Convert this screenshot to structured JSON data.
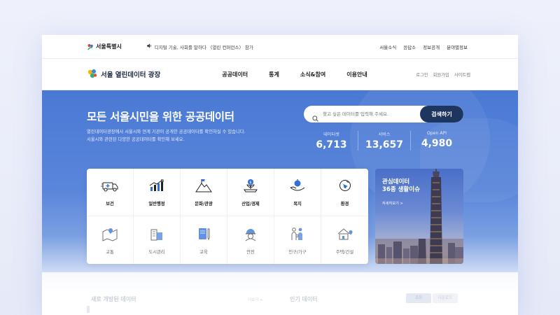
{
  "topbar": {
    "city_name": "서울특별시",
    "notice": "디지털 기술, 사회를 말하다 〈열린 컨퍼런스〉 참가",
    "links": [
      "서울소식",
      "응답소",
      "정보공개",
      "분야별정보"
    ]
  },
  "nav": {
    "site_name": "서울 열린데이터 광장",
    "menu": [
      "공공데이터",
      "통계",
      "소식&참여",
      "이용안내"
    ],
    "member_links": [
      "로그인",
      "회원가입",
      "사이트맵"
    ]
  },
  "hero": {
    "title": "모든 서울시민을 위한 공공데이터",
    "desc_line1": "열린데이터광장에서 서울시와 연계 기관이 공개한 공공데이터를 확인하실 수 있습니다.",
    "desc_line2": "서울시와 관련된 다양한 공공데이터를 확인해 보세요.",
    "search_placeholder": "찾고 싶은 데이터를 입력해 주세요.",
    "search_button": "검색하기",
    "stats": [
      {
        "label": "데이터셋",
        "value": "6,713"
      },
      {
        "label": "서비스",
        "value": "13,657"
      },
      {
        "label": "Open API",
        "value": "4,980"
      }
    ]
  },
  "categories": [
    {
      "label": "보건",
      "icon": "ambulance-icon"
    },
    {
      "label": "일반행정",
      "icon": "chart-growth-icon"
    },
    {
      "label": "문화/관광",
      "icon": "mountain-flag-icon"
    },
    {
      "label": "산업/경제",
      "icon": "money-plant-icon"
    },
    {
      "label": "복지",
      "icon": "hand-heart-icon"
    },
    {
      "label": "환경",
      "icon": "globe-leaf-icon"
    },
    {
      "label": "교통",
      "icon": "map-pin-icon"
    },
    {
      "label": "도시관리",
      "icon": "buildings-icon"
    },
    {
      "label": "교육",
      "icon": "book-pencil-icon"
    },
    {
      "label": "안전",
      "icon": "helmet-worker-icon"
    },
    {
      "label": "인구/가구",
      "icon": "family-icon"
    },
    {
      "label": "주택/건설",
      "icon": "house-pin-icon"
    }
  ],
  "banner": {
    "title_line1": "관심데이터",
    "title_line2": "36종 생활이슈",
    "more": "자세히보기 >"
  },
  "lower": {
    "section1": "새로 개방된 데이터",
    "section1_more": "더보기 +",
    "section2": "인기 데이터",
    "tab1": "조회",
    "tab2": "다운로드"
  },
  "colors": {
    "hero_blue": "#4a79d4",
    "search_button": "#1e3560",
    "icon_accent": "#2f6fd6"
  }
}
